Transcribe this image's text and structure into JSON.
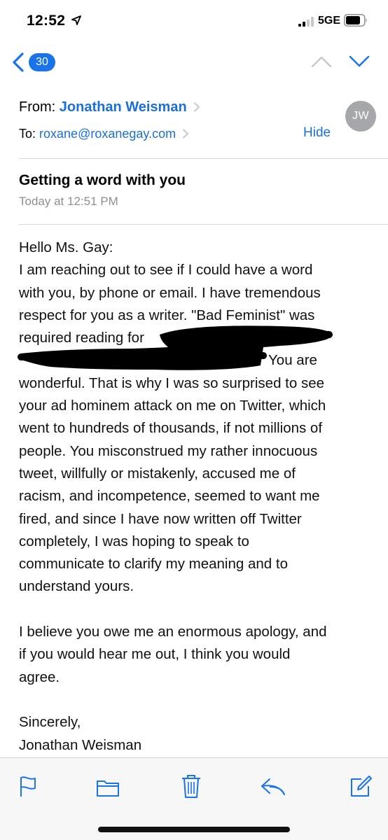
{
  "status_bar": {
    "time": "12:52",
    "network": "5GE",
    "icons": [
      "location-arrow-icon",
      "signal-bars-icon",
      "battery-icon"
    ]
  },
  "nav": {
    "back_count": "30",
    "icons": [
      "back-chevron-icon",
      "up-chevron-icon",
      "down-chevron-icon"
    ],
    "accent_color": "#1a73e8"
  },
  "header": {
    "from_label": "From:",
    "sender_name": "Jonathan Weisman",
    "to_label": "To:",
    "to_address": "roxane@roxanegay.com",
    "avatar_initials": "JW",
    "hide_label": "Hide",
    "link_color": "#1c6fd6"
  },
  "message": {
    "subject": "Getting a word with you",
    "date": "Today at 12:51 PM",
    "lines": [
      "Hello Ms. Gay:",
      "I am reaching out to see if I could have a word",
      "with you, by phone or email. I have tremendous",
      "respect for you as a writer. \"Bad Feminist\" was",
      "required reading for",
      "You are",
      "wonderful. That is why I was so surprised to see",
      "your ad hominem attack on me on Twitter, which",
      "went to hundreds of thousands, if not millions of",
      "people. You misconstrued my rather innocuous",
      "tweet, willfully or mistakenly, accused me of",
      "racism, and incompetence, seemed to want me",
      "fired, and since I have now written off Twitter",
      "completely, I was hoping to speak to",
      "communicate to clarify my meaning and to",
      "understand yours.",
      "I believe you owe me an enormous apology, and",
      "if you would hear me out, I think you would",
      "agree.",
      "Sincerely,",
      "Jonathan Weisman"
    ]
  },
  "toolbar": {
    "icons": [
      "flag-icon",
      "folder-icon",
      "trash-icon",
      "reply-icon",
      "compose-icon"
    ]
  }
}
